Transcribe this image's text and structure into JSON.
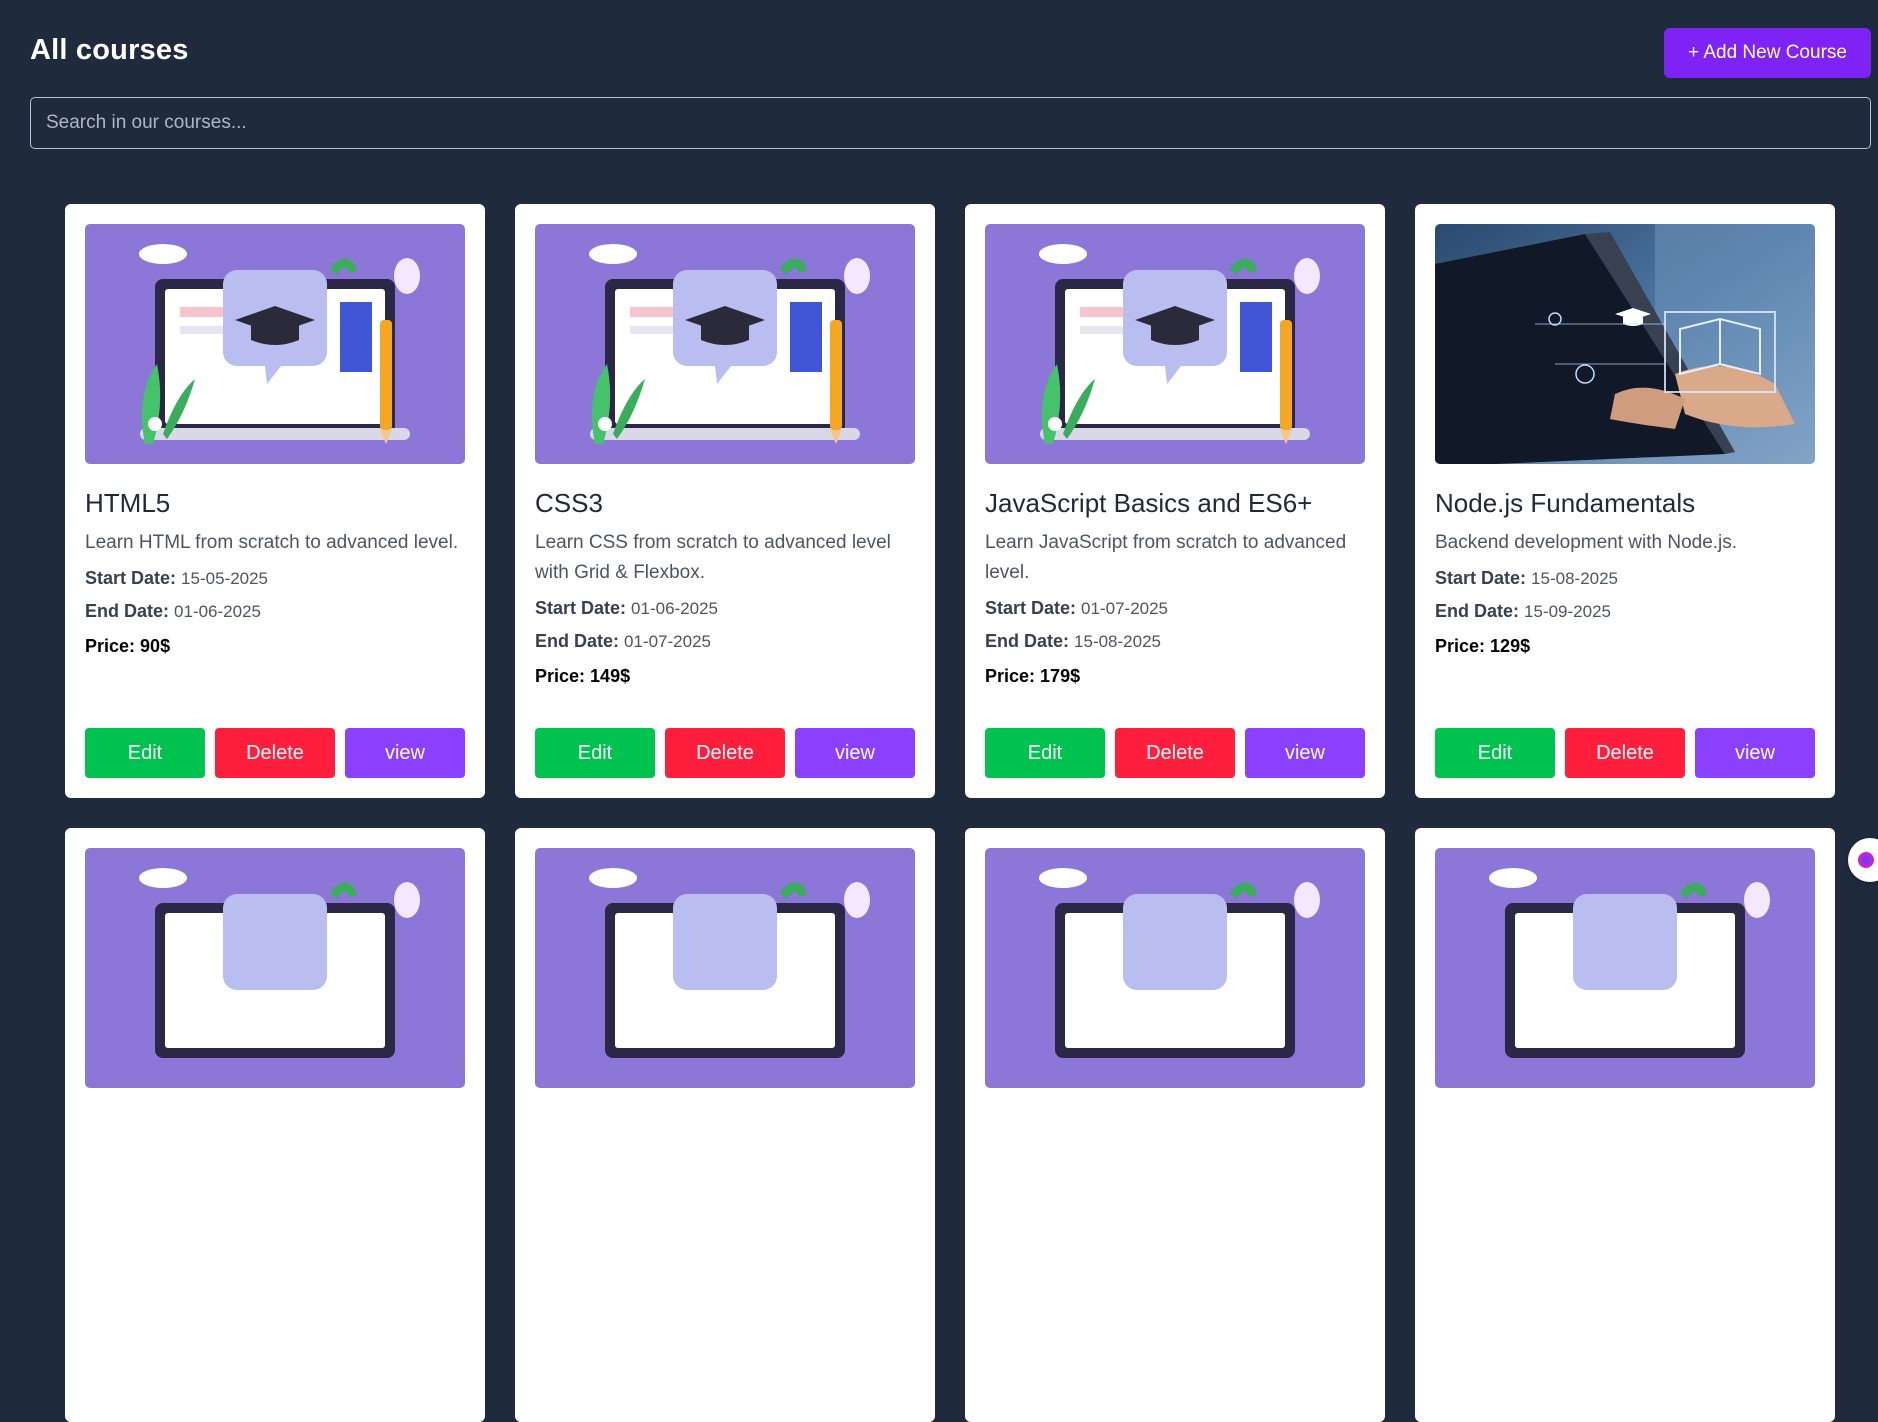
{
  "header": {
    "title": "All courses",
    "add_button_label": "+ Add New Course"
  },
  "search": {
    "placeholder": "Search in our courses...",
    "value": ""
  },
  "labels": {
    "start_date": "Start Date:",
    "end_date": "End Date:",
    "price": "Price:"
  },
  "buttons": {
    "edit": "Edit",
    "delete": "Delete",
    "view": "view"
  },
  "courses": [
    {
      "title": "HTML5",
      "description": "Learn HTML from scratch to advanced level.",
      "start_date": "15-05-2025",
      "end_date": "01-06-2025",
      "price": "90$",
      "image": "graduation-laptop-illustration"
    },
    {
      "title": "CSS3",
      "description": "Learn CSS from scratch to advanced level with Grid & Flexbox.",
      "start_date": "01-06-2025",
      "end_date": "01-07-2025",
      "price": "149$",
      "image": "graduation-laptop-illustration"
    },
    {
      "title": "JavaScript Basics and ES6+",
      "description": "Learn JavaScript from scratch to advanced level.",
      "start_date": "01-07-2025",
      "end_date": "15-08-2025",
      "price": "179$",
      "image": "graduation-laptop-illustration"
    },
    {
      "title": "Node.js Fundamentals",
      "description": "Backend development with Node.js.",
      "start_date": "15-08-2025",
      "end_date": "15-09-2025",
      "price": "129$",
      "image": "laptop-hands-photo"
    }
  ],
  "colors": {
    "background": "#1f2a3c",
    "primary": "#7e22f5",
    "edit": "#00c24e",
    "delete": "#ff1f3d",
    "view": "#8b40ff",
    "illustration_bg": "#8b73d6"
  }
}
